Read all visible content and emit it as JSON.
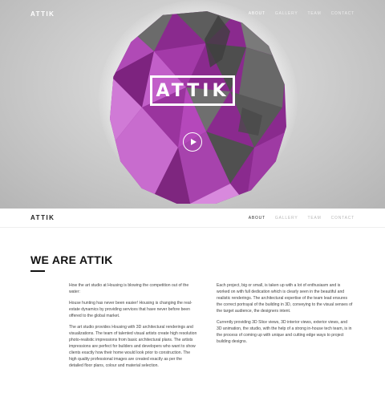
{
  "hero": {
    "logo": "ATTIK",
    "nav": [
      {
        "label": "ABOUT",
        "active": true
      },
      {
        "label": "GALLERY",
        "active": false
      },
      {
        "label": "TEAM",
        "active": false
      },
      {
        "label": "CONTACT",
        "active": false
      }
    ],
    "brand": "ATTIK"
  },
  "navbar": {
    "logo": "ATTIK",
    "nav": [
      {
        "label": "ABOUT",
        "active": true
      },
      {
        "label": "GALLERY",
        "active": false
      },
      {
        "label": "TEAM",
        "active": false
      },
      {
        "label": "CONTACT",
        "active": false
      }
    ]
  },
  "section": {
    "title": "WE ARE ATTIK",
    "left_paragraphs": [
      "How the art studio at Housing is blowing the competition out of the water:",
      "House hunting has never been easier! Housing is changing the real-estate dynamics by providing services that have never before been offered to the global market.",
      "The art studio provides Housing with 3D architectural renderings and visualizations. The team of talented visual artists create high resolution photo-realistic impressions from basic architectural plans. The artists impressions are perfect for builders and developers who want to show clients exactly how their home would look prior to construction. The high quality professional images are created exactly as per the detailed floor plans, colour and material selection."
    ],
    "right_paragraphs": [
      "Each project, big or small, is taken up with a lot of enthusiasm and is worked on with full dedication which is clearly seen in the beautiful and realistic renderings. The architectural expertise of the team lead ensures the correct portrayal of the building in 3D, conveying to the visual senses of the target audience, the designers intent.",
      "Currently providing 3D Slice views, 3D interior views, exterior views, and 3D animation, the studio, with the help of a strong in-house tech team, is in the process of coming up with unique and cutting edge ways to project building designs."
    ]
  },
  "colors": {
    "accent": "#9b2c9e",
    "dark": "#111111"
  }
}
